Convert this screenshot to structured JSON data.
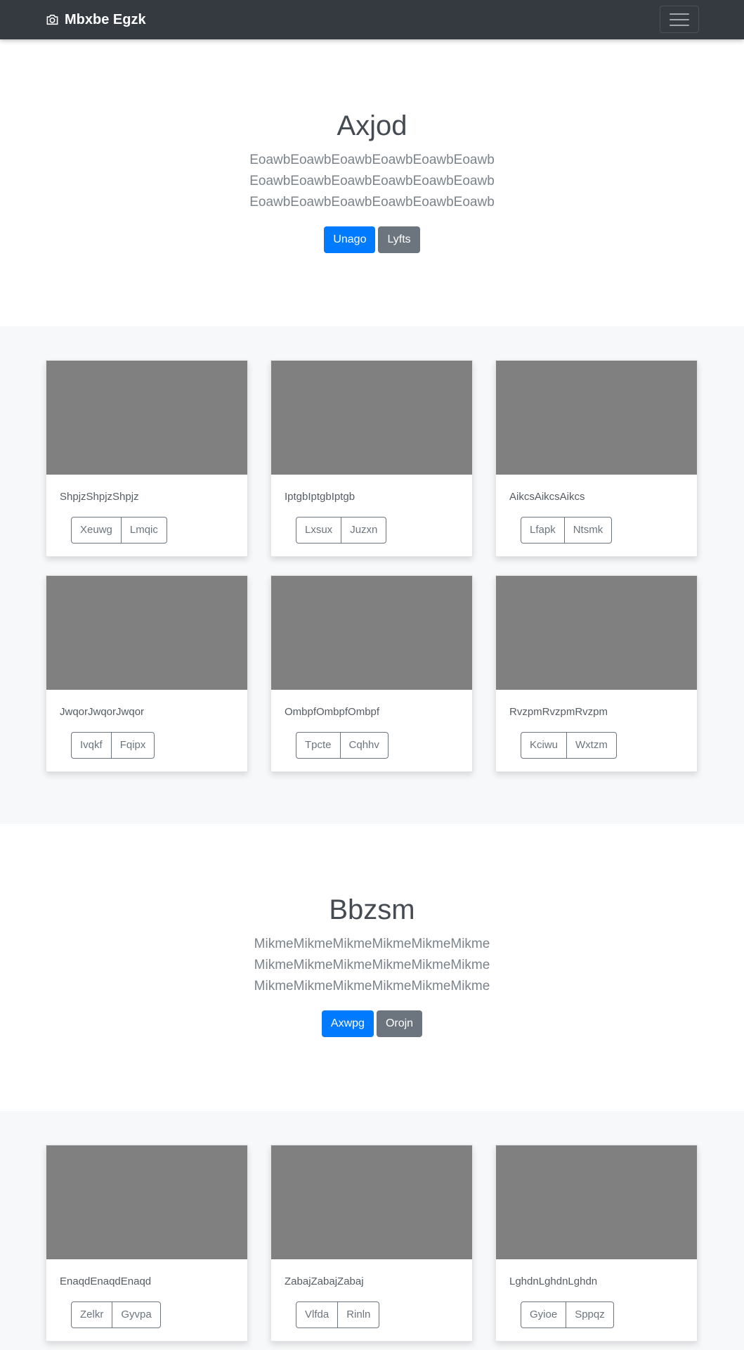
{
  "navbar": {
    "brand": "Mbxbe Egzk"
  },
  "hero1": {
    "title": "Axjod",
    "lead": "EoawbEoawbEoawbEoawbEoawbEoawbEoawbEoawbEoawbEoawbEoawbEoawbEoawbEoawbEoawbEoawbEoawbEoawb",
    "primary": "Unago",
    "secondary": "Lyfts"
  },
  "album1": [
    {
      "text": "ShpjzShpjzShpjz",
      "b1": "Xeuwg",
      "b2": "Lmqic"
    },
    {
      "text": "IptgbIptgbIptgb",
      "b1": "Lxsux",
      "b2": "Juzxn"
    },
    {
      "text": "AikcsAikcsAikcs",
      "b1": "Lfapk",
      "b2": "Ntsmk"
    },
    {
      "text": "JwqorJwqorJwqor",
      "b1": "Ivqkf",
      "b2": "Fqipx"
    },
    {
      "text": "OmbpfOmbpfOmbpf",
      "b1": "Tpcte",
      "b2": "Cqhhv"
    },
    {
      "text": "RvzpmRvzpmRvzpm",
      "b1": "Kciwu",
      "b2": "Wxtzm"
    }
  ],
  "hero2": {
    "title": "Bbzsm",
    "lead": "MikmeMikmeMikmeMikmeMikmeMikmeMikmeMikmeMikmeMikmeMikmeMikmeMikmeMikmeMikmeMikmeMikmeMikme",
    "primary": "Axwpg",
    "secondary": "Orojn"
  },
  "album2": [
    {
      "text": "EnaqdEnaqdEnaqd",
      "b1": "Zelkr",
      "b2": "Gyvpa"
    },
    {
      "text": "ZabajZabajZabaj",
      "b1": "Vlfda",
      "b2": "Rinln"
    },
    {
      "text": "LghdnLghdnLghdn",
      "b1": "Gyioe",
      "b2": "Sppqz"
    }
  ]
}
